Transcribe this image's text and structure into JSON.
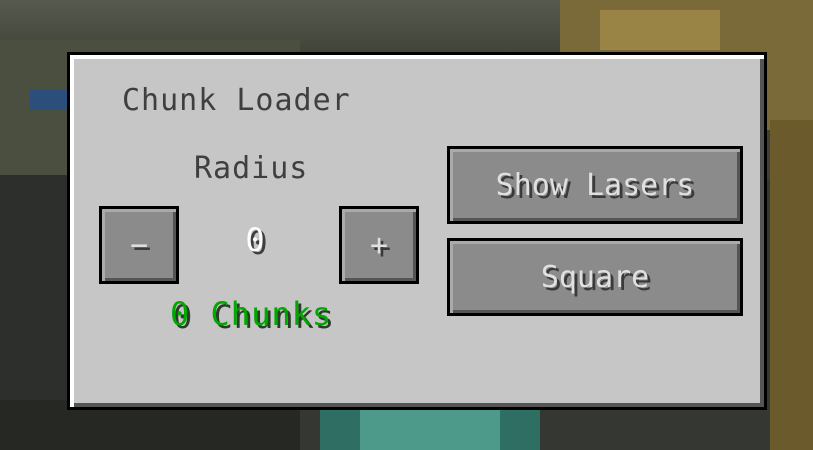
{
  "panel": {
    "title": "Chunk Loader",
    "radius_label": "Radius",
    "radius_value": "0",
    "decrease_label": "−",
    "increase_label": "+",
    "chunks_text": "0 Chunks",
    "show_lasers_label": "Show Lasers",
    "shape_label": "Square"
  },
  "colors": {
    "panel_bg": "#c6c6c6",
    "button_bg": "#8b8b8b",
    "chunks_text": "#00a800",
    "title_text": "#3f3f3f"
  }
}
